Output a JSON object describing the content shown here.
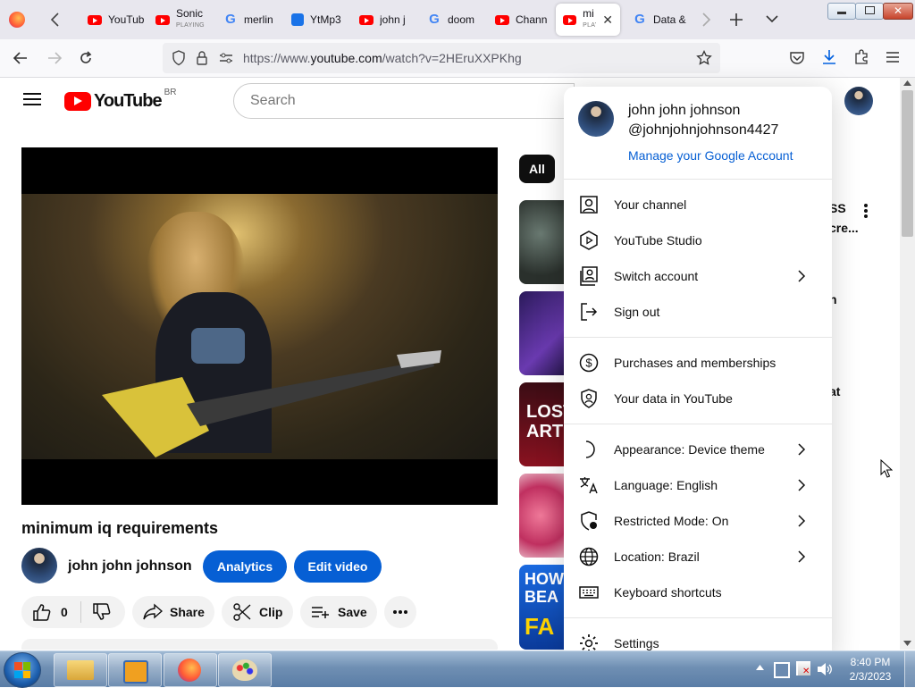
{
  "browser": {
    "tabs": [
      {
        "title": "YouTube",
        "favicon": "youtube-icon"
      },
      {
        "title": "Sonic",
        "subtitle": "PLAYING",
        "favicon": "youtube-icon"
      },
      {
        "title": "merlin",
        "favicon": "google-icon"
      },
      {
        "title": "YtMp3",
        "favicon": "ytmp3-icon"
      },
      {
        "title": "john j",
        "favicon": "youtube-icon"
      },
      {
        "title": "doom",
        "favicon": "google-icon"
      },
      {
        "title": "Chann",
        "favicon": "youtube-icon"
      },
      {
        "title": "mi",
        "subtitle": "PLAYING",
        "favicon": "youtube-icon",
        "active": true
      },
      {
        "title": "Data &",
        "favicon": "google-icon"
      }
    ],
    "url_prefix": "https://www.",
    "url_domain": "youtube.com",
    "url_path": "/watch?v=2HEruXXPKhg"
  },
  "youtube": {
    "logo_text": "YouTube",
    "region": "BR",
    "search_placeholder": "Search",
    "chip_all": "All",
    "video": {
      "title": "minimum iq requirements",
      "channel": "john john johnson",
      "analytics_label": "Analytics",
      "edit_label": "Edit video",
      "like_count": "0",
      "share_label": "Share",
      "clip_label": "Clip",
      "save_label": "Save"
    },
    "sidebar_fragments": [
      "SS",
      "cre...",
      "n",
      "at"
    ]
  },
  "account_menu": {
    "name": "john john johnson",
    "handle": "@johnjohnjohnson4427",
    "manage_link": "Manage your Google Account",
    "sections": [
      [
        {
          "label": "Your channel",
          "icon": "person-icon",
          "chevron": false
        },
        {
          "label": "YouTube Studio",
          "icon": "studio-icon",
          "chevron": false
        },
        {
          "label": "Switch account",
          "icon": "switch-account-icon",
          "chevron": true
        },
        {
          "label": "Sign out",
          "icon": "sign-out-icon",
          "chevron": false
        }
      ],
      [
        {
          "label": "Purchases and memberships",
          "icon": "dollar-icon",
          "chevron": false
        },
        {
          "label": "Your data in YouTube",
          "icon": "shield-person-icon",
          "chevron": false
        }
      ],
      [
        {
          "label": "Appearance: Device theme",
          "icon": "moon-icon",
          "chevron": true
        },
        {
          "label": "Language: English",
          "icon": "translate-icon",
          "chevron": true
        },
        {
          "label": "Restricted Mode: On",
          "icon": "restricted-icon",
          "chevron": true
        },
        {
          "label": "Location: Brazil",
          "icon": "globe-icon",
          "chevron": true
        },
        {
          "label": "Keyboard shortcuts",
          "icon": "keyboard-icon",
          "chevron": false
        }
      ],
      [
        {
          "label": "Settings",
          "icon": "gear-icon",
          "chevron": false
        }
      ]
    ]
  },
  "taskbar": {
    "time": "8:40 PM",
    "date": "2/3/2023"
  },
  "colors": {
    "accent_blue": "#065fd4",
    "youtube_red": "#ff0000",
    "link_blue": "#065fd4"
  }
}
